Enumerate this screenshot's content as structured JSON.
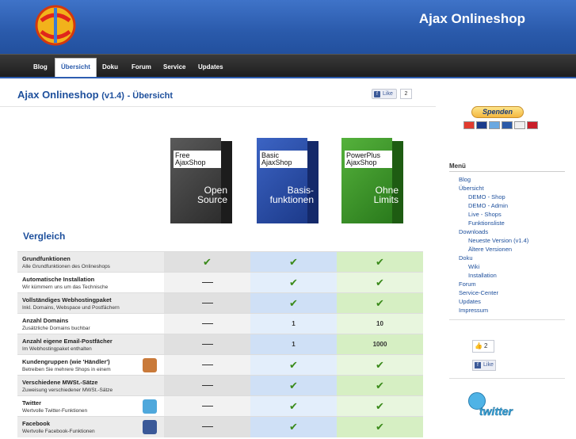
{
  "header": {
    "site_title": "Ajax Onlineshop"
  },
  "nav": [
    {
      "label": "Blog",
      "active": false
    },
    {
      "label": "Übersicht",
      "active": true
    },
    {
      "label": "Doku",
      "active": false
    },
    {
      "label": "Forum",
      "active": false
    },
    {
      "label": "Service",
      "active": false
    },
    {
      "label": "Updates",
      "active": false
    }
  ],
  "page": {
    "title": "Ajax Onlineshop",
    "title_version": "(v1.4)",
    "title_suffix": "- Übersicht",
    "fb_like_label": "Like",
    "fb_like_count": "2"
  },
  "products": [
    {
      "line1": "Free",
      "line2": "AjaxShop",
      "big1": "Open",
      "big2": "Source",
      "color": "#4a4a4a"
    },
    {
      "line1": "Basic",
      "line2": "AjaxShop",
      "big1": "Basis-",
      "big2": "funktionen",
      "color": "#2c4fa8"
    },
    {
      "line1": "PowerPlus",
      "line2": "AjaxShop",
      "big1": "Ohne",
      "big2": "Limits",
      "color": "#3a9a2a"
    }
  ],
  "comparison": {
    "heading": "Vergleich",
    "rows": [
      {
        "name": "Grundfunktionen",
        "desc": "Alle Grundfunktionen des Onlineshops",
        "free": "check",
        "basic": "check",
        "power": "check"
      },
      {
        "name": "Automatische Installation",
        "desc": "Wir kümmern uns um das Technische",
        "free": "dash",
        "basic": "check",
        "power": "check"
      },
      {
        "name": "Vollständiges Webhostingpaket",
        "desc": "Inkl. Domains, Webspace und Postfächern",
        "free": "dash",
        "basic": "check",
        "power": "check"
      },
      {
        "name": "Anzahl Domains",
        "desc": "Zusätzliche Domains buchbar",
        "free": "dash",
        "basic": "1",
        "power": "10"
      },
      {
        "name": "Anzahl eigene Email-Postfächer",
        "desc": "Im Webhostingpaket enthalten",
        "free": "dash",
        "basic": "1",
        "power": "1000"
      },
      {
        "name": "Kundengruppen (wie 'Händler')",
        "desc": "Betreiben Sie mehrere Shops in einem",
        "free": "dash",
        "basic": "check",
        "power": "check",
        "icon": "users-icon"
      },
      {
        "name": "Verschiedene MWSt.-Sätze",
        "desc": "Zuweisung verschiedener MWSt.-Sätze",
        "free": "dash",
        "basic": "check",
        "power": "check"
      },
      {
        "name": "Twitter",
        "desc": "Wertvolle Twitter-Funktionen",
        "free": "dash",
        "basic": "check",
        "power": "check",
        "icon": "twitter-icon"
      },
      {
        "name": "Facebook",
        "desc": "Wertvolle Facebook-Funktionen",
        "free": "dash",
        "basic": "check",
        "power": "check",
        "icon": "facebook-icon"
      }
    ]
  },
  "sidebar": {
    "donate_label": "Spenden",
    "menu_title": "Menü",
    "menu": [
      {
        "label": "Blog",
        "level": 1
      },
      {
        "label": "Übersicht",
        "level": 1
      },
      {
        "label": "DEMO - Shop",
        "level": 2
      },
      {
        "label": "DEMO - Admin",
        "level": 2
      },
      {
        "label": "Live - Shops",
        "level": 2
      },
      {
        "label": "Funktionsliste",
        "level": 2
      },
      {
        "label": "Downloads",
        "level": 1
      },
      {
        "label": "Neueste Version (v1.4)",
        "level": 2
      },
      {
        "label": "Ältere Versionen",
        "level": 2
      },
      {
        "label": "Doku",
        "level": 1
      },
      {
        "label": "Wiki",
        "level": 2
      },
      {
        "label": "Installation",
        "level": 2
      },
      {
        "label": "Forum",
        "level": 1
      },
      {
        "label": "Service-Center",
        "level": 1
      },
      {
        "label": "Updates",
        "level": 1
      },
      {
        "label": "Impressum",
        "level": 1
      }
    ],
    "like_count": "2",
    "like_label": "Like",
    "twitter_label": "twitter"
  },
  "colors": {
    "accent": "#1d4f9c",
    "header": "#2a5aab",
    "check": "#3a8a1a"
  }
}
